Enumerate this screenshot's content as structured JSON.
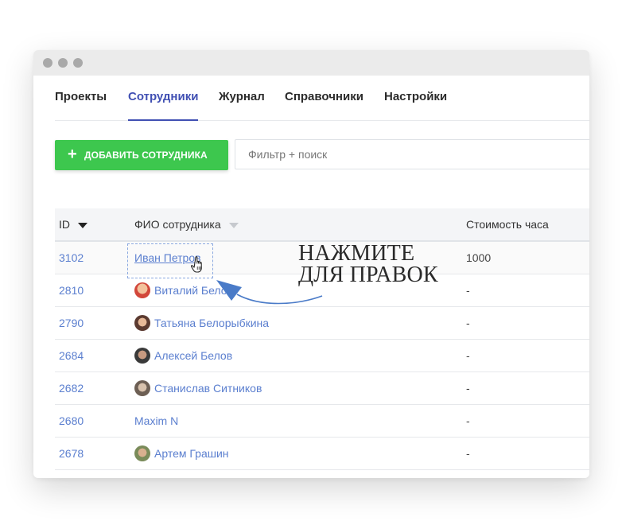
{
  "nav": {
    "tabs": [
      {
        "label": "Проекты"
      },
      {
        "label": "Сотрудники",
        "active": true
      },
      {
        "label": "Журнал"
      },
      {
        "label": "Справочники"
      },
      {
        "label": "Настройки"
      }
    ]
  },
  "toolbar": {
    "add_button_icon": "plus-icon",
    "add_button_label": "ДОБАВИТЬ СОТРУДНИКА",
    "search_placeholder": "Фильтр + поиск",
    "search_value": ""
  },
  "table": {
    "columns": {
      "id": "ID",
      "name": "ФИО сотрудника",
      "cost": "Стоимость часа"
    },
    "rows": [
      {
        "id": "3102",
        "name": "Иван Петров",
        "cost": "1000"
      },
      {
        "id": "2810",
        "name": "Виталий Белов",
        "cost": "-"
      },
      {
        "id": "2790",
        "name": "Татьяна Белорыбкина",
        "cost": "-"
      },
      {
        "id": "2684",
        "name": "Алексей Белов",
        "cost": "-"
      },
      {
        "id": "2682",
        "name": "Станислав Ситников",
        "cost": "-"
      },
      {
        "id": "2680",
        "name": "Maxim N",
        "cost": "-"
      },
      {
        "id": "2678",
        "name": "Артем Грашин",
        "cost": "-"
      }
    ]
  },
  "annotation": {
    "line1": "НАЖМИТЕ",
    "line2": "ДЛЯ ПРАВОК"
  },
  "colors": {
    "accent": "#4150b3",
    "add_button": "#3dc74e",
    "link": "#5b7fcf",
    "arrow": "#4a7bc8"
  }
}
